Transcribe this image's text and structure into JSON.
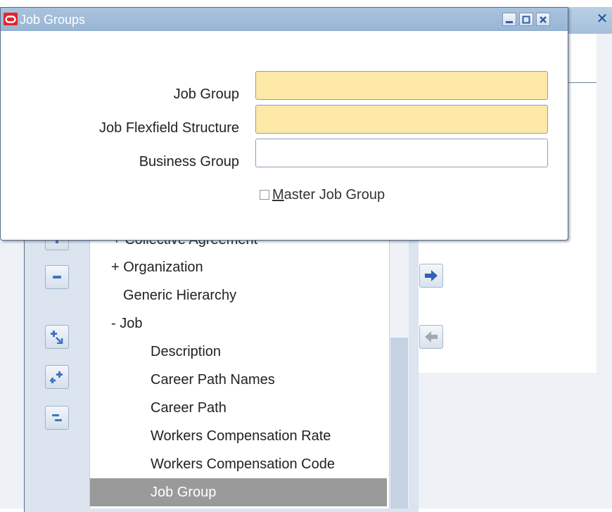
{
  "dialog": {
    "title": "Job Groups",
    "fields": {
      "job_group": {
        "label": "Job Group",
        "value": ""
      },
      "job_flexfield_structure": {
        "label": "Job Flexfield Structure",
        "value": ""
      },
      "business_group": {
        "label": "Business Group",
        "value": ""
      }
    },
    "master_job_group": {
      "mnemonic": "M",
      "label_rest": "aster Job Group",
      "checked": false
    }
  },
  "navigator": {
    "partial_item": "+ Collective Agreement",
    "items": [
      "+ Organization",
      "Generic Hierarchy",
      "- Job",
      "Description",
      "Career Path Names",
      "Career Path",
      "Workers Compensation Rate",
      "Workers Compensation Code",
      "Job Group"
    ],
    "selected_item": "Job Group"
  },
  "colors": {
    "required_field": "#fde8a8",
    "titlebar": "#a9c3de",
    "selected_row": "#9a9a9a",
    "oracle_logo": "#e8222b"
  },
  "icons": {
    "dialog_logo": "oracle-logo-icon",
    "minimize": "minimize-icon",
    "maximize": "maximize-icon",
    "close": "close-icon"
  }
}
